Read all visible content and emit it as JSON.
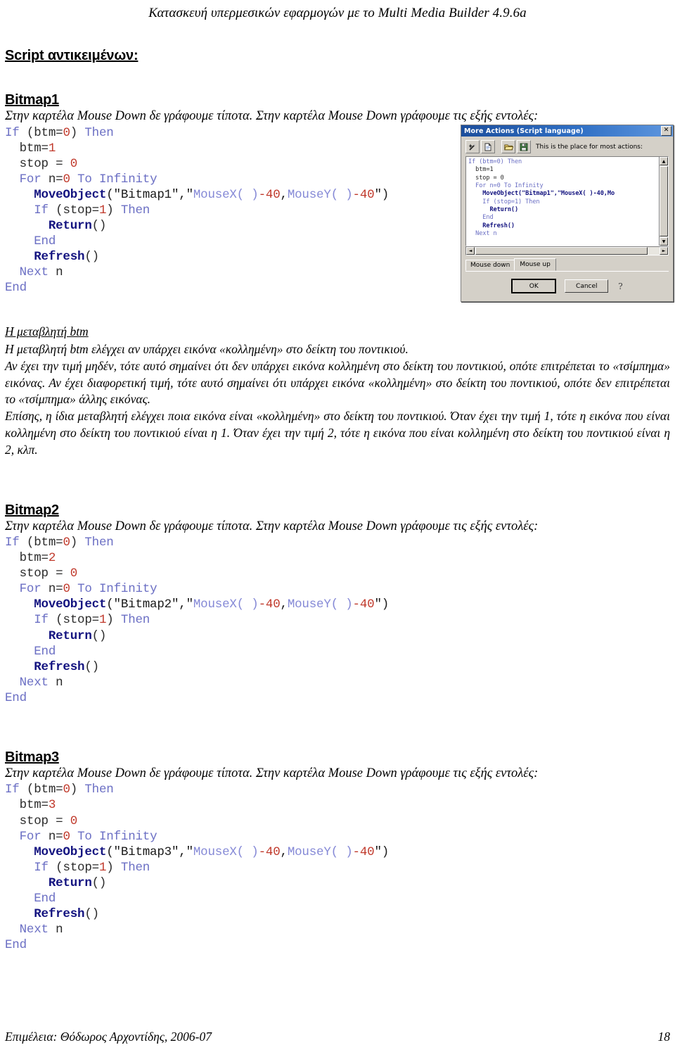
{
  "header": {
    "title": "Κατασκευή υπερμεσικών εφαρμογών με το Multi Media Builder 4.9.6a"
  },
  "section": {
    "heading": "Script αντικειμένων:"
  },
  "bitmap1": {
    "heading": "Bitmap1",
    "description": "Στην καρτέλα Mouse Down δε γράφουμε τίποτα. Στην καρτέλα Mouse Down γράφουμε τις εξής εντολές:",
    "code": {
      "line1_kw_if": "If",
      "line1_cond": "(btm=",
      "line1_zero": "0",
      "line1_close": ")",
      "line1_then": "Then",
      "line2_var": "btm=",
      "line2_val": "1",
      "line3_var": "stop = ",
      "line3_val": "0",
      "line4_for": "For",
      "line4_n": "n=",
      "line4_zero": "0",
      "line4_to": "To",
      "line4_inf": "Infinity",
      "line5_fn": "MoveObject",
      "line5_open": "(\"Bitmap1\",\"",
      "line5_mx": "MouseX( )",
      "line5_m40a": "-40",
      "line5_comma": ",",
      "line5_my": "MouseY( )",
      "line5_m40b": "-40",
      "line5_close": "\")",
      "line6_if": "If",
      "line6_cond": "(stop=",
      "line6_one": "1",
      "line6_close": ")",
      "line6_then": "Then",
      "line7_return": "Return",
      "line7_parens": "()",
      "line8_end": "End",
      "line9_refresh": "Refresh",
      "line9_parens": "()",
      "line10_next": "Next",
      "line10_n": "n",
      "line11_end": "End"
    }
  },
  "bitmap2": {
    "heading": "Bitmap2",
    "description": "Στην καρτέλα Mouse Down δε γράφουμε τίποτα. Στην καρτέλα Mouse Down γράφουμε τις εξής εντολές:",
    "code": {
      "line1_kw_if": "If",
      "line1_cond": "(btm=",
      "line1_zero": "0",
      "line1_close": ")",
      "line1_then": "Then",
      "line2_var": "btm=",
      "line2_val": "2",
      "line3_var": "stop = ",
      "line3_val": "0",
      "line4_for": "For",
      "line4_n": "n=",
      "line4_zero": "0",
      "line4_to": "To",
      "line4_inf": "Infinity",
      "line5_fn": "MoveObject",
      "line5_open": "(\"Bitmap2\",\"",
      "line5_mx": "MouseX( )",
      "line5_m40a": "-40",
      "line5_comma": ",",
      "line5_my": "MouseY( )",
      "line5_m40b": "-40",
      "line5_close": "\")",
      "line6_if": "If",
      "line6_cond": "(stop=",
      "line6_one": "1",
      "line6_close": ")",
      "line6_then": "Then",
      "line7_return": "Return",
      "line7_parens": "()",
      "line8_end": "End",
      "line9_refresh": "Refresh",
      "line9_parens": "()",
      "line10_next": "Next",
      "line10_n": "n",
      "line11_end": "End"
    }
  },
  "bitmap3": {
    "heading": "Bitmap3",
    "description": "Στην καρτέλα Mouse Down δε γράφουμε τίποτα. Στην καρτέλα Mouse Down γράφουμε τις εξής εντολές:",
    "code": {
      "line1_kw_if": "If",
      "line1_cond": "(btm=",
      "line1_zero": "0",
      "line1_close": ")",
      "line1_then": "Then",
      "line2_var": "btm=",
      "line2_val": "3",
      "line3_var": "stop = ",
      "line3_val": "0",
      "line4_for": "For",
      "line4_n": "n=",
      "line4_zero": "0",
      "line4_to": "To",
      "line4_inf": "Infinity",
      "line5_fn": "MoveObject",
      "line5_open": "(\"Bitmap3\",\"",
      "line5_mx": "MouseX( )",
      "line5_m40a": "-40",
      "line5_comma": ",",
      "line5_my": "MouseY( )",
      "line5_m40b": "-40",
      "line5_close": "\")",
      "line6_if": "If",
      "line6_cond": "(stop=",
      "line6_one": "1",
      "line6_close": ")",
      "line6_then": "Then",
      "line7_return": "Return",
      "line7_parens": "()",
      "line8_end": "End",
      "line9_refresh": "Refresh",
      "line9_parens": "()",
      "line10_next": "Next",
      "line10_n": "n",
      "line11_end": "End"
    }
  },
  "explanation": {
    "title": "Η μεταβλητή btm",
    "para1": "Η μεταβλητή btm ελέγχει αν υπάρχει εικόνα «κολλημένη» στο δείκτη του ποντικιού.",
    "para2": "Αν έχει την τιμή μηδέν, τότε αυτό σημαίνει ότι δεν υπάρχει εικόνα κολλημένη στο δείκτη του ποντικιού, οπότε επιτρέπεται το «τσίμπημα» εικόνας. Αν έχει διαφορετική τιμή, τότε αυτό σημαίνει ότι υπάρχει εικόνα «κολλημένη» στο δείκτη του ποντικιού, οπότε δεν επιτρέπεται το «τσίμπημα» άλλης εικόνας.",
    "para3": "Επίσης, η ίδια μεταβλητή ελέγχει ποια εικόνα είναι «κολλημένη» στο δείκτη του ποντικιού. Όταν έχει την τιμή 1, τότε η εικόνα που είναι κολλημένη στο δείκτη του ποντικιού είναι η 1. Όταν έχει την τιμή 2, τότε η εικόνα που είναι κολλημένη στο δείκτη του ποντικιού είναι η 2, κλπ."
  },
  "dialog": {
    "title": "More Actions (Script language)",
    "close_label": "✕",
    "toolbar": {
      "label": "This is the place for most actions:",
      "buttons": [
        "wand-icon",
        "new-document-icon",
        "open-folder-icon",
        "save-disk-icon"
      ]
    },
    "code_lines": [
      "If (btm=0) Then",
      "  btm=1",
      "  stop = 0",
      "  For n=0 To Infinity",
      "    MoveObject(\"Bitmap1\",\"MouseX( )-40,Mo",
      "    If (stop=1) Then",
      "      Return()",
      "    End",
      "    Refresh()",
      "  Next n"
    ],
    "tabs": [
      {
        "label": "Mouse down",
        "active": false
      },
      {
        "label": "Mouse up",
        "active": true
      }
    ],
    "buttons": {
      "ok": "OK",
      "cancel": "Cancel",
      "help": "?"
    },
    "scroll": {
      "up": "▲",
      "down": "▼",
      "left": "◄",
      "right": "►"
    }
  },
  "footer": {
    "credit": "Επιμέλεια: Θόδωρος Αρχοντίδης, 2006-07",
    "page_number": "18"
  },
  "colors": {
    "keyword": "#6b6fc4",
    "number": "#c0392b",
    "function": "#141480",
    "identifier": "#8488d6",
    "titlebar": "#1c4e9c",
    "dialog_face": "#d4d0c8"
  }
}
